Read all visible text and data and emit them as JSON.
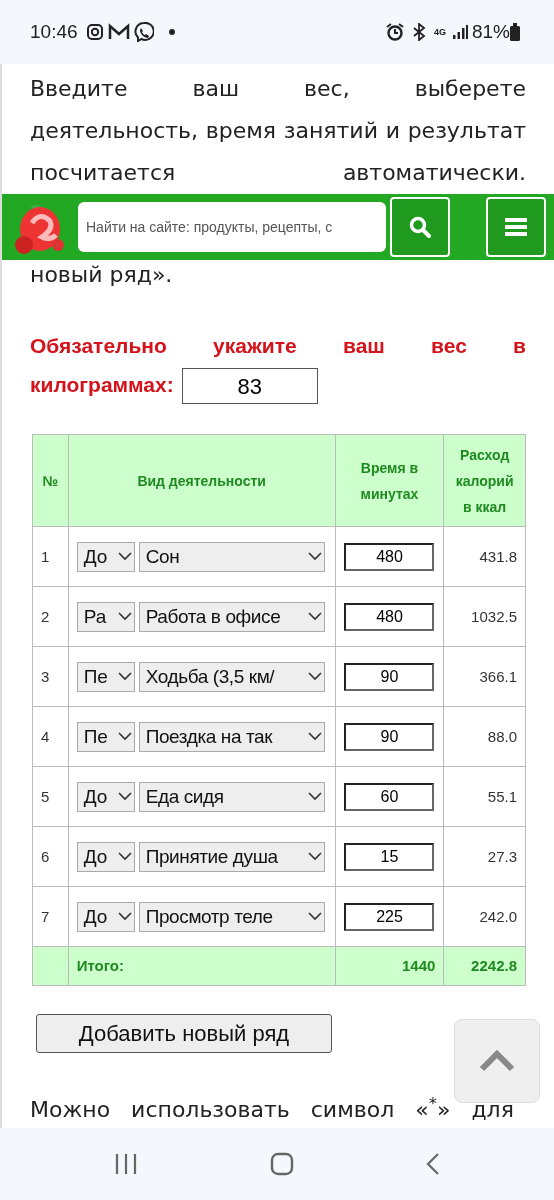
{
  "status_bar": {
    "time": "10:46",
    "network": "4G",
    "battery": "81%"
  },
  "intro": {
    "text": "Введите ваш вес, выберете деятельность, время занятий и результат посчитается автоматически.",
    "tail": "новый ряд»."
  },
  "header": {
    "search": {
      "placeholder": "Найти на сайте: продукты, рецепты, с"
    }
  },
  "weight": {
    "label_lines": [
      "Обязательно укажите ваш вес в",
      "килограммах:"
    ],
    "value": "83"
  },
  "table": {
    "columns": [
      "№",
      "Вид деятельности",
      "Время в минутах",
      "Расход калорий в ккал"
    ],
    "rows": [
      {
        "number": "1",
        "category": "До",
        "activity": "Сон",
        "minutes": "480",
        "kcal": "431.8"
      },
      {
        "number": "2",
        "category": "Ра",
        "activity": "Работа в офисе",
        "minutes": "480",
        "kcal": "1032.5"
      },
      {
        "number": "3",
        "category": "Пе",
        "activity": "Ходьба (3,5 км/",
        "minutes": "90",
        "kcal": "366.1"
      },
      {
        "number": "4",
        "category": "Пе",
        "activity": "Поездка на так",
        "minutes": "90",
        "kcal": "88.0"
      },
      {
        "number": "5",
        "category": "До",
        "activity": "Еда сидя",
        "minutes": "60",
        "kcal": "55.1"
      },
      {
        "number": "6",
        "category": "До",
        "activity": "Принятие душа",
        "minutes": "15",
        "kcal": "27.3"
      },
      {
        "number": "7",
        "category": "До",
        "activity": "Просмотр теле",
        "minutes": "225",
        "kcal": "242.0"
      }
    ],
    "total": {
      "label": "Итого:",
      "minutes": "1440",
      "kcal": "2242.8"
    }
  },
  "add_button": "Добавить новый ряд",
  "note": "Можно использовать символ «$^{*}$» для"
}
